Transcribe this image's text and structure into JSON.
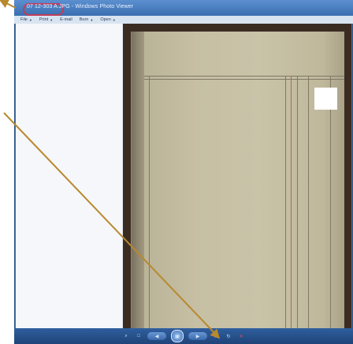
{
  "window": {
    "title": "07 12-303 A.JPG - Windows Photo Viewer"
  },
  "menu": {
    "items": [
      {
        "label": "File",
        "has_dropdown": true
      },
      {
        "label": "Print",
        "has_dropdown": true
      },
      {
        "label": "E-mail",
        "has_dropdown": false
      },
      {
        "label": "Burn",
        "has_dropdown": true
      },
      {
        "label": "Open",
        "has_dropdown": true
      }
    ]
  },
  "controls": {
    "icons": [
      "zoom-icon",
      "fit-icon",
      "previous-icon",
      "slideshow-icon",
      "next-icon",
      "rotate-left-icon",
      "rotate-right-icon",
      "delete-icon"
    ]
  },
  "colors": {
    "titlebar": "#3a6fb0",
    "annotation_arrow": "#b8892e",
    "annotation_circle": "#c23a5a"
  }
}
